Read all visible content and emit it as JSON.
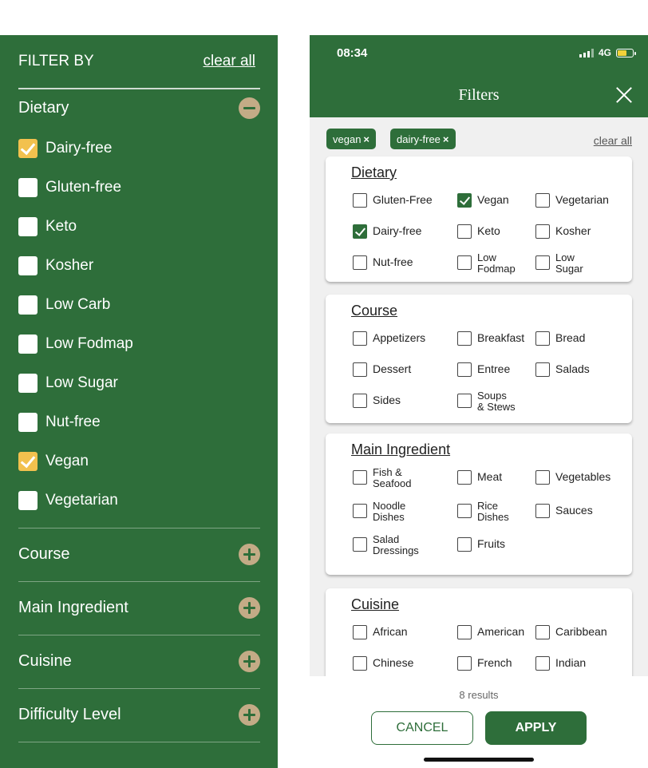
{
  "left_panel": {
    "header": "FILTER BY",
    "clear_all": "clear all",
    "dietary_title": "Dietary",
    "dietary_options": [
      {
        "label": "Dairy-free",
        "checked": true
      },
      {
        "label": "Gluten-free",
        "checked": false
      },
      {
        "label": "Keto",
        "checked": false
      },
      {
        "label": "Kosher",
        "checked": false
      },
      {
        "label": "Low Carb",
        "checked": false
      },
      {
        "label": "Low Fodmap",
        "checked": false
      },
      {
        "label": "Low Sugar",
        "checked": false
      },
      {
        "label": "Nut-free",
        "checked": false
      },
      {
        "label": "Vegan",
        "checked": true
      },
      {
        "label": "Vegetarian",
        "checked": false
      }
    ],
    "collapsed_sections": [
      "Course",
      "Main Ingredient",
      "Cuisine",
      "Difficulty Level"
    ]
  },
  "phone": {
    "status_time": "08:34",
    "network": "4G",
    "title": "Filters",
    "chips": [
      "vegan",
      "dairy-free"
    ],
    "clear_all": "clear all",
    "cards": [
      {
        "title": "Dietary",
        "options": [
          {
            "label": "Gluten-Free",
            "checked": false
          },
          {
            "label": "Vegan",
            "checked": true
          },
          {
            "label": "Vegetarian",
            "checked": false
          },
          {
            "label": "Dairy-free",
            "checked": true
          },
          {
            "label": "Keto",
            "checked": false
          },
          {
            "label": "Kosher",
            "checked": false
          },
          {
            "label": "Nut-free",
            "checked": false
          },
          {
            "label": "Low\nFodmap",
            "checked": false
          },
          {
            "label": "Low\nSugar",
            "checked": false
          }
        ]
      },
      {
        "title": "Course",
        "options": [
          {
            "label": "Appetizers",
            "checked": false
          },
          {
            "label": "Breakfast",
            "checked": false
          },
          {
            "label": "Bread",
            "checked": false
          },
          {
            "label": "Dessert",
            "checked": false
          },
          {
            "label": "Entree",
            "checked": false
          },
          {
            "label": "Salads",
            "checked": false
          },
          {
            "label": "Sides",
            "checked": false
          },
          {
            "label": "Soups\n& Stews",
            "checked": false
          }
        ]
      },
      {
        "title": "Main Ingredient",
        "options": [
          {
            "label": "Fish &\nSeafood",
            "checked": false
          },
          {
            "label": "Meat",
            "checked": false
          },
          {
            "label": "Vegetables",
            "checked": false
          },
          {
            "label": "Noodle\nDishes",
            "checked": false
          },
          {
            "label": "Rice\nDishes",
            "checked": false
          },
          {
            "label": "Sauces",
            "checked": false
          },
          {
            "label": "Salad\nDressings",
            "checked": false
          },
          {
            "label": "Fruits",
            "checked": false
          }
        ]
      },
      {
        "title": "Cuisine",
        "options": [
          {
            "label": "African",
            "checked": false
          },
          {
            "label": "American",
            "checked": false
          },
          {
            "label": "Caribbean",
            "checked": false
          },
          {
            "label": "Chinese",
            "checked": false
          },
          {
            "label": "French",
            "checked": false
          },
          {
            "label": "Indian",
            "checked": false
          }
        ]
      }
    ],
    "results": "8 results",
    "cancel": "CANCEL",
    "apply": "APPLY"
  },
  "colors": {
    "brand_green": "#2e6e3a",
    "checked_yellow": "#f2c14e",
    "toggle_tan": "#c3ab86"
  }
}
